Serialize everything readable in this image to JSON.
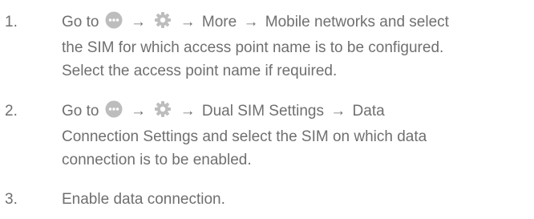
{
  "steps": [
    {
      "number": "1.",
      "line1": {
        "go_to": "Go to",
        "arrow_a": "→",
        "arrow_b": "→",
        "more": "More",
        "arrow_c": "→",
        "tail": "Mobile networks and select"
      },
      "line2": "the SIM for which access point name is to be configured.",
      "line3": "Select the access point name if required.",
      "icons": [
        "apps-grid-icon",
        "settings-gear-icon"
      ]
    },
    {
      "number": "2.",
      "line1": {
        "go_to": "Go to",
        "arrow_a": "→",
        "arrow_b": "→",
        "dual_sim": "Dual SIM Settings",
        "arrow_c": "→",
        "tail": "Data"
      },
      "line2": "Connection Settings and select the SIM on which data",
      "line3": "connection is to be enabled.",
      "icons": [
        "apps-grid-icon",
        "settings-gear-icon"
      ]
    },
    {
      "number": "3.",
      "line1": "Enable data connection."
    }
  ],
  "colors": {
    "text": "#6f6f6f",
    "icon_fill": "#bdbdbd"
  }
}
